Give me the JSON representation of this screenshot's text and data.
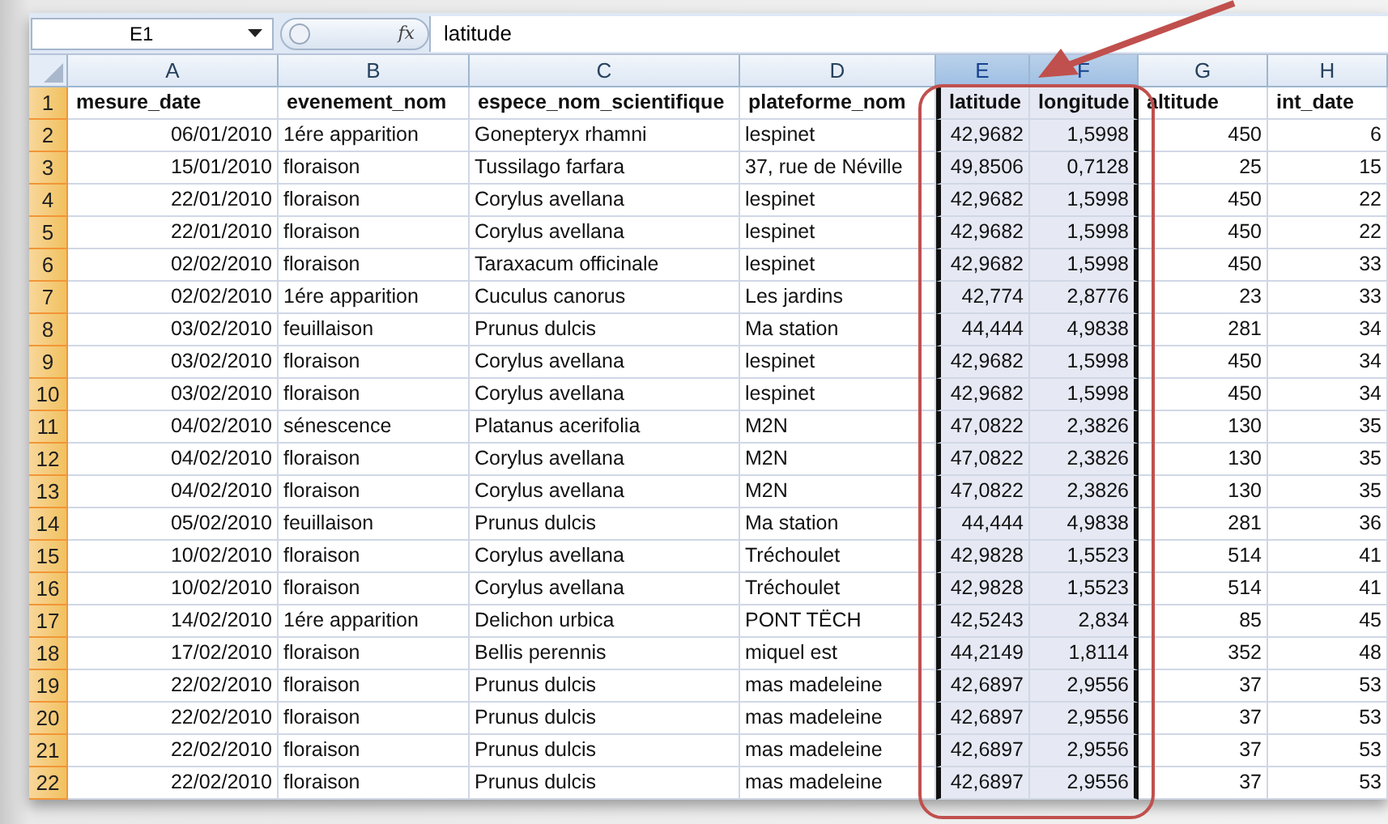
{
  "formula_bar": {
    "name_box": "E1",
    "fx": "fx",
    "formula": "latitude"
  },
  "columns": [
    {
      "letter": "A",
      "kind": "date",
      "selected": false
    },
    {
      "letter": "B",
      "kind": "text",
      "selected": false
    },
    {
      "letter": "C",
      "kind": "text",
      "selected": false
    },
    {
      "letter": "D",
      "kind": "text",
      "selected": false
    },
    {
      "letter": "E",
      "kind": "number",
      "selected": true
    },
    {
      "letter": "F",
      "kind": "number",
      "selected": true
    },
    {
      "letter": "G",
      "kind": "number",
      "selected": false
    },
    {
      "letter": "H",
      "kind": "number",
      "selected": false
    }
  ],
  "header_row": {
    "n": "1",
    "selected": true,
    "cells": [
      "mesure_date",
      "evenement_nom",
      "espece_nom_scientifique",
      "plateforme_nom",
      "latitude",
      "longitude",
      "altitude",
      "int_date"
    ]
  },
  "rows": [
    {
      "n": "2",
      "selected": true,
      "cells": [
        "06/01/2010",
        "1ére apparition",
        "Gonepteryx rhamni",
        "lespinet",
        "42,9682",
        "1,5998",
        "450",
        "6"
      ]
    },
    {
      "n": "3",
      "selected": true,
      "cells": [
        "15/01/2010",
        "floraison",
        "Tussilago farfara",
        "37, rue de Néville",
        "49,8506",
        "0,7128",
        "25",
        "15"
      ]
    },
    {
      "n": "4",
      "selected": true,
      "cells": [
        "22/01/2010",
        "floraison",
        "Corylus avellana",
        "lespinet",
        "42,9682",
        "1,5998",
        "450",
        "22"
      ]
    },
    {
      "n": "5",
      "selected": true,
      "cells": [
        "22/01/2010",
        "floraison",
        "Corylus avellana",
        "lespinet",
        "42,9682",
        "1,5998",
        "450",
        "22"
      ]
    },
    {
      "n": "6",
      "selected": true,
      "cells": [
        "02/02/2010",
        "floraison",
        "Taraxacum officinale",
        "lespinet",
        "42,9682",
        "1,5998",
        "450",
        "33"
      ]
    },
    {
      "n": "7",
      "selected": true,
      "cells": [
        "02/02/2010",
        "1ére apparition",
        "Cuculus canorus",
        "Les jardins",
        "42,774",
        "2,8776",
        "23",
        "33"
      ]
    },
    {
      "n": "8",
      "selected": true,
      "cells": [
        "03/02/2010",
        "feuillaison",
        "Prunus dulcis",
        "Ma station",
        "44,444",
        "4,9838",
        "281",
        "34"
      ]
    },
    {
      "n": "9",
      "selected": true,
      "cells": [
        "03/02/2010",
        "floraison",
        "Corylus avellana",
        "lespinet",
        "42,9682",
        "1,5998",
        "450",
        "34"
      ]
    },
    {
      "n": "10",
      "selected": true,
      "cells": [
        "03/02/2010",
        "floraison",
        "Corylus avellana",
        "lespinet",
        "42,9682",
        "1,5998",
        "450",
        "34"
      ]
    },
    {
      "n": "11",
      "selected": true,
      "cells": [
        "04/02/2010",
        "sénescence",
        "Platanus acerifolia",
        "M2N",
        "47,0822",
        "2,3826",
        "130",
        "35"
      ]
    },
    {
      "n": "12",
      "selected": true,
      "cells": [
        "04/02/2010",
        "floraison",
        "Corylus avellana",
        "M2N",
        "47,0822",
        "2,3826",
        "130",
        "35"
      ]
    },
    {
      "n": "13",
      "selected": true,
      "cells": [
        "04/02/2010",
        "floraison",
        "Corylus avellana",
        "M2N",
        "47,0822",
        "2,3826",
        "130",
        "35"
      ]
    },
    {
      "n": "14",
      "selected": true,
      "cells": [
        "05/02/2010",
        "feuillaison",
        "Prunus dulcis",
        "Ma station",
        "44,444",
        "4,9838",
        "281",
        "36"
      ]
    },
    {
      "n": "15",
      "selected": true,
      "cells": [
        "10/02/2010",
        "floraison",
        "Corylus avellana",
        "Tréchoulet",
        "42,9828",
        "1,5523",
        "514",
        "41"
      ]
    },
    {
      "n": "16",
      "selected": true,
      "cells": [
        "10/02/2010",
        "floraison",
        "Corylus avellana",
        "Tréchoulet",
        "42,9828",
        "1,5523",
        "514",
        "41"
      ]
    },
    {
      "n": "17",
      "selected": true,
      "cells": [
        "14/02/2010",
        "1ére apparition",
        "Delichon urbica",
        "PONT TËCH",
        "42,5243",
        "2,834",
        "85",
        "45"
      ]
    },
    {
      "n": "18",
      "selected": true,
      "cells": [
        "17/02/2010",
        "floraison",
        "Bellis perennis",
        "miquel est",
        "44,2149",
        "1,8114",
        "352",
        "48"
      ]
    },
    {
      "n": "19",
      "selected": true,
      "cells": [
        "22/02/2010",
        "floraison",
        "Prunus dulcis",
        "mas madeleine",
        "42,6897",
        "2,9556",
        "37",
        "53"
      ]
    },
    {
      "n": "20",
      "selected": true,
      "cells": [
        "22/02/2010",
        "floraison",
        "Prunus dulcis",
        "mas madeleine",
        "42,6897",
        "2,9556",
        "37",
        "53"
      ]
    },
    {
      "n": "21",
      "selected": true,
      "cells": [
        "22/02/2010",
        "floraison",
        "Prunus dulcis",
        "mas madeleine",
        "42,6897",
        "2,9556",
        "37",
        "53"
      ]
    },
    {
      "n": "22",
      "selected": true,
      "cells": [
        "22/02/2010",
        "floraison",
        "Prunus dulcis",
        "mas madeleine",
        "42,6897",
        "2,9556",
        "37",
        "53"
      ]
    }
  ]
}
